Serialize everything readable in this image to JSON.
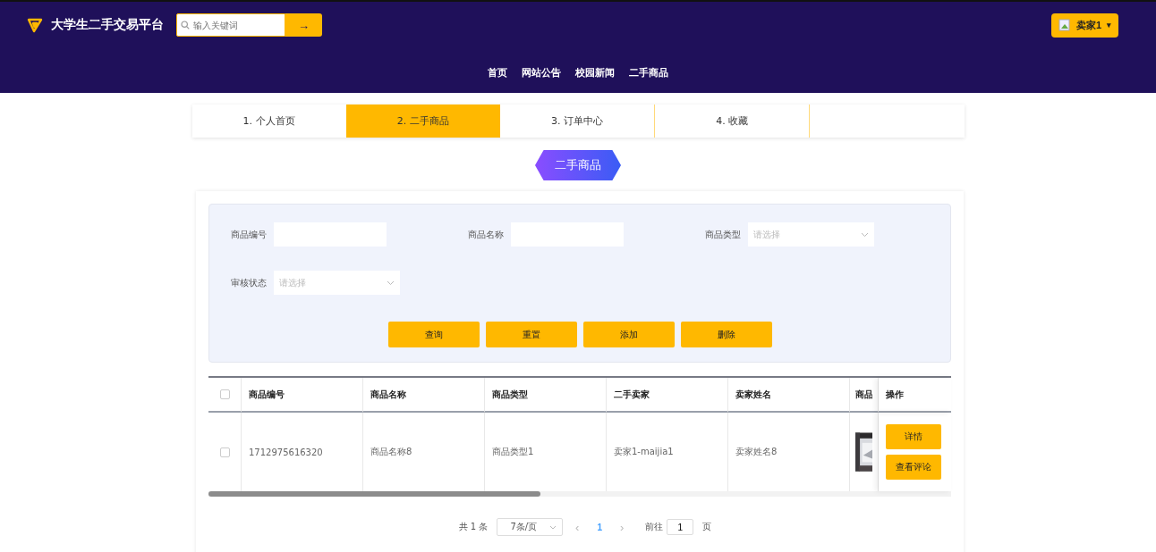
{
  "header": {
    "brand": "大学生二手交易平台",
    "search": {
      "placeholder": "输入关键词",
      "button": "→"
    },
    "user": {
      "name": "卖家1",
      "caret": "▾"
    }
  },
  "nav": [
    "首页",
    "网站公告",
    "校园新闻",
    "二手商品"
  ],
  "tabs": [
    {
      "label": "1. 个人首页",
      "selected": false
    },
    {
      "label": "2. 二手商品",
      "selected": true
    },
    {
      "label": "3. 订单中心",
      "selected": false
    },
    {
      "label": "4. 收藏",
      "selected": false
    }
  ],
  "page_title": "二手商品",
  "filters": [
    {
      "label": "商品编号",
      "kind": "input"
    },
    {
      "label": "商品名称",
      "kind": "input"
    },
    {
      "label": "商品类型",
      "kind": "select",
      "placeholder": "请选择"
    },
    {
      "label": "审核状态",
      "kind": "select",
      "placeholder": "请选择"
    }
  ],
  "actions": [
    "查询",
    "重置",
    "添加",
    "删除"
  ],
  "table": {
    "all_checked": false,
    "columns": [
      "商品编号",
      "商品名称",
      "商品类型",
      "二手卖家",
      "卖家姓名",
      "商品"
    ],
    "action_column": "操作",
    "rows": [
      {
        "checked": false,
        "cells": [
          "1712975616320",
          "商品名称8",
          "商品类型1",
          "卖家1-maijia1",
          "卖家姓名8"
        ],
        "image": {
          "kind": "picture"
        },
        "buttons": [
          "详情",
          "查看评论"
        ]
      }
    ]
  },
  "pagination": {
    "total": "共 1 条",
    "page_size": "7条/页",
    "prev": "‹",
    "current": "1",
    "next": "›",
    "goto_label": "前往",
    "goto_value": "1",
    "goto_suffix": "页"
  }
}
